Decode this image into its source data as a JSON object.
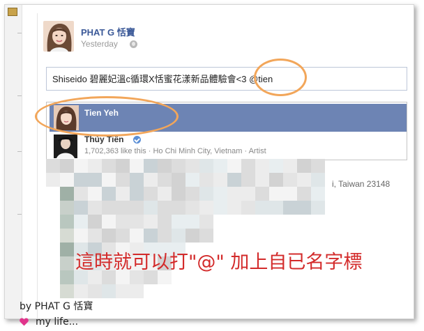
{
  "post": {
    "author": "PHAT G 恬寶",
    "time": "Yesterday"
  },
  "composer": {
    "text": "Shiseido 碧麗妃溫c循環X恬蜜花漾新品體驗會<3 @tien"
  },
  "mention_suggestions": [
    {
      "name": "Tien Yeh",
      "selected": true
    },
    {
      "name": "Thủy Tiên",
      "verified": true,
      "meta": "1,702,363 like this · Ho Chi Minh City, Vietnam · Artist"
    }
  ],
  "obscured": {
    "address_fragment": "i, Taiwan 23148"
  },
  "caption": "這時就可以打\"@\" 加上自已名字標",
  "signature": {
    "line1": "by PHAT G 恬寶",
    "line2": "my life..."
  },
  "colors": {
    "highlight_row": "#6d84b4",
    "link_blue": "#3b5998",
    "circle": "#f2a65a",
    "caption_red": "#d32b2b",
    "heart": "#e0338b"
  },
  "icons": [
    "globe-icon",
    "verified-icon",
    "heart-icon"
  ]
}
